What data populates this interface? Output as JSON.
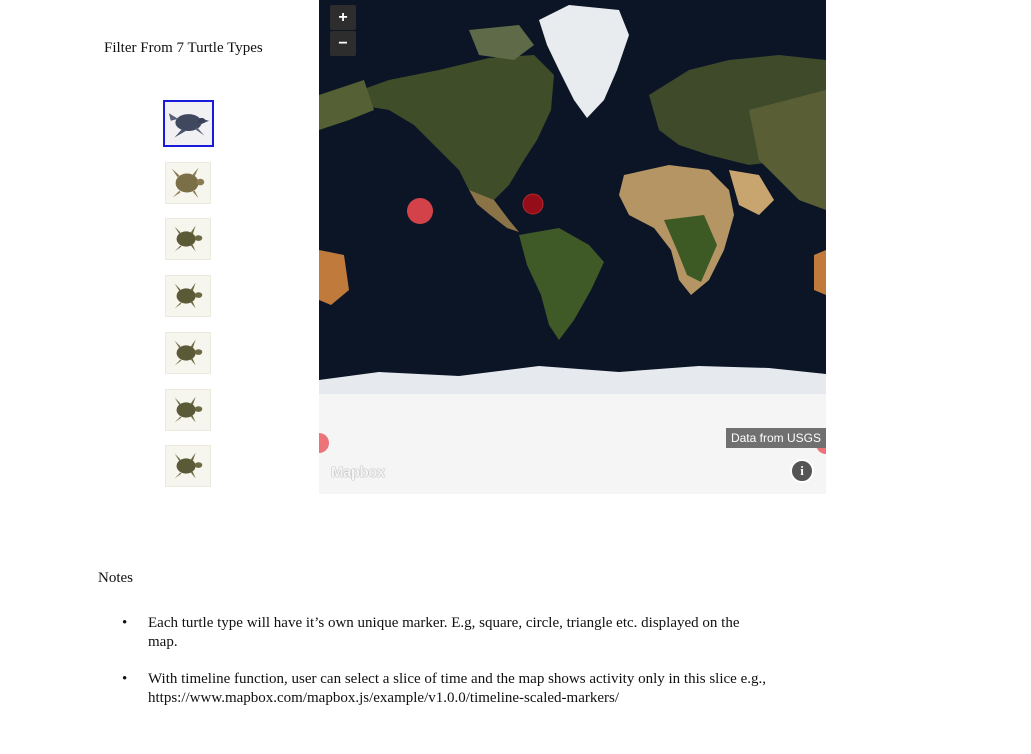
{
  "filter": {
    "title": "Filter From 7 Turtle Types",
    "turtles": [
      {
        "icon": "leatherback-turtle-icon",
        "selected": true
      },
      {
        "icon": "loggerhead-turtle-icon",
        "selected": false
      },
      {
        "icon": "green-turtle-icon",
        "selected": false
      },
      {
        "icon": "green-turtle-icon",
        "selected": false
      },
      {
        "icon": "green-turtle-icon",
        "selected": false
      },
      {
        "icon": "green-turtle-icon",
        "selected": false
      },
      {
        "icon": "green-turtle-icon",
        "selected": false
      }
    ]
  },
  "map": {
    "zoom_in": "+",
    "zoom_out": "−",
    "attribution": "Data from USGS",
    "logo": "Mapbox",
    "info": "i",
    "marker_color": "#e8474d"
  },
  "notes": {
    "title": "Notes",
    "items": [
      "Each turtle type will have it’s own unique marker. E.g, square, circle, triangle etc. displayed on the map.",
      "With timeline function, user can select a slice of time and the map shows activity only in this slice e.g., https://www.mapbox.com/mapbox.js/example/v1.0.0/timeline-scaled-markers/"
    ]
  }
}
